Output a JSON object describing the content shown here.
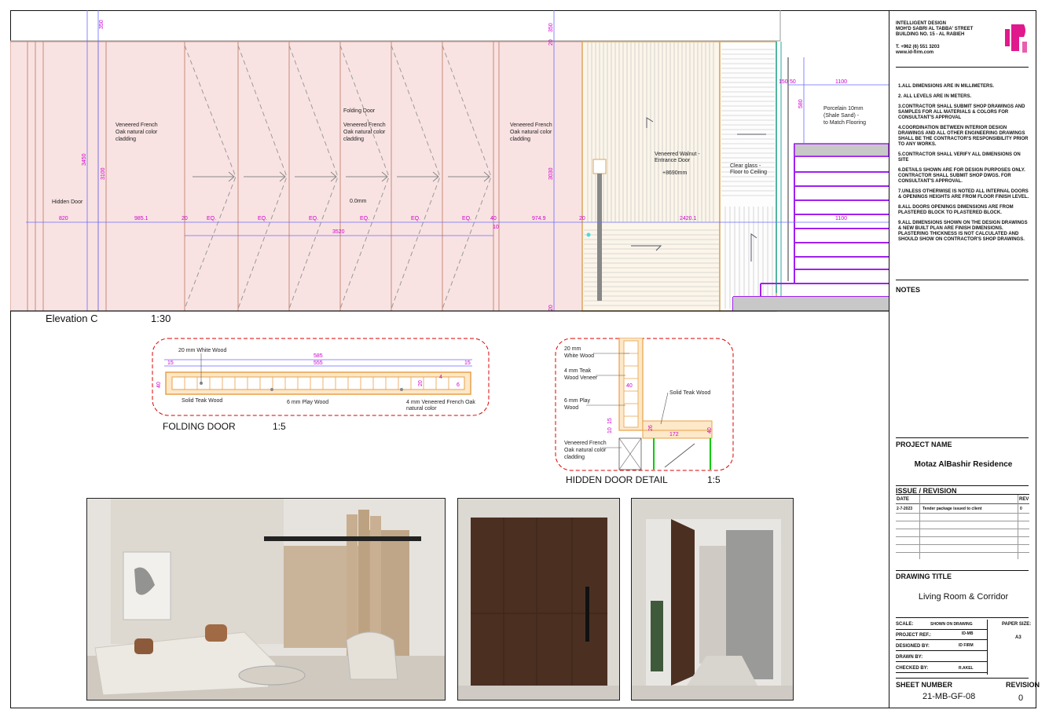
{
  "elevation": {
    "title": "Elevation C",
    "scale": "1:30",
    "labels": {
      "hidden_door": "Hidden Door",
      "veneer_left_1": "Veneered French",
      "veneer_left_2": "Oak natural color",
      "veneer_left_3": "cladding",
      "folding_door": "Folding Door",
      "veneer_mid_1": "Veneered French",
      "veneer_mid_2": "Oak natural color",
      "veneer_mid_3": "cladding",
      "veneer_right_1": "Veneered French",
      "veneer_right_2": "Oak natural color",
      "veneer_right_3": "cladding",
      "walnut_1": "Veneered Walnut -",
      "walnut_2": "Entrance Door",
      "walnut_3": "+8690mm",
      "glass_1": "Clear glass -",
      "glass_2": "Floor to Ceiling",
      "porcelain_1": "Porcelain 10mm",
      "porcelain_2": "(Shale Sand) -",
      "porcelain_3": "to Match Flooring",
      "level": "0.0mm"
    },
    "dims": {
      "d350a": "350",
      "d350b": "350",
      "d3450": "3450",
      "d3100": "3100",
      "d3030": "3030",
      "d20a": "20",
      "d20b": "20",
      "d820": "820",
      "d985": "985.1",
      "d20c": "20",
      "eq1": "EQ.",
      "eq2": "EQ.",
      "eq3": "EQ.",
      "eq4": "EQ.",
      "eq5": "EQ.",
      "eq6": "EQ.",
      "d40": "40",
      "d10": "10",
      "d974": "974.9",
      "d20d": "20",
      "d2420": "2420.1",
      "d1100a": "1100",
      "d1100b": "1100",
      "d3520": "3520",
      "d580": "580",
      "d150": "150",
      "d50": "50"
    }
  },
  "folding_door": {
    "title": "FOLDING DOOR",
    "scale": "1:5",
    "labels": {
      "white_wood": "20 mm White Wood",
      "solid_teak": "Solid Teak Wood",
      "play_wood": "6 mm Play Wood",
      "veneer_1": "4 mm Veneered French Oak",
      "veneer_2": "natural color"
    },
    "dims": {
      "d585": "585",
      "d555": "555",
      "d15a": "15",
      "d15b": "15",
      "d40": "40",
      "d20": "20",
      "d4": "4",
      "d6": "6"
    }
  },
  "hidden_door": {
    "title": "HIDDEN DOOR DETAIL",
    "scale": "1:5",
    "labels": {
      "white_1": "20 mm",
      "white_2": "White Wood",
      "teak_v1": "4 mm Teak",
      "teak_v2": "Wood Veneer",
      "play_1": "6 mm Play",
      "play_2": "Wood",
      "solid_teak": "Solid Teak Wood",
      "veneer_1": "Veneered French",
      "veneer_2": "Oak natural color",
      "veneer_3": "cladding"
    },
    "dims": {
      "d40a": "40",
      "d26": "26",
      "d172": "172",
      "d40b": "40",
      "d10": "10",
      "d15": "15"
    }
  },
  "title_block": {
    "company": [
      "INTELLIGENT DESIGN",
      "MOH'D SABRI AL TABBA' STREET",
      "BUILDING NO. 15 - AL RABIEH"
    ],
    "phone": "T. +962 (6) 551 3203",
    "web": "www.id-firm.com",
    "notes": [
      "1.ALL DIMENSIONS ARE IN MILLIMETERS.",
      "2. ALL LEVELS ARE IN METERS.",
      "3.CONTRACTOR SHALL SUBMIT SHOP DRAWINGS AND SAMPLES FOR ALL MATERIALS & COLORS FOR CONSULTANT'S APPROVAL",
      "4.COORDINATION BETWEEN INTERIOR DESIGN DRAWINGS AND ALL OTHER ENGINEERING DRAWINGS SHALL BE THE CONTRACTOR'S RESPONSIBILITY PRIOR TO ANY WORKS.",
      "5.CONTRACTOR SHALL VERIFY ALL DIMENSIONS ON SITE",
      "6.DETAILS SHOWN ARE FOR DESIGN PURPOSES ONLY. CONTRACTOR SHALL SUBMIT SHOP DWGS. FOR CONSULTANT'S APPROVAL.",
      "7.UNLESS OTHERWISE IS NOTED ALL INTERNAL DOORS & OPENINGS HEIGHTS ARE FROM FLOOR FINISH LEVEL.",
      "8.ALL DOORS OPENINGS DIMENSIONS ARE FROM PLASTERED BLOCK TO PLASTERED BLOCK.",
      "9.ALL DIMENSIONS SHOWN ON THE DESIGN DRAWINGS & NEW BUILT PLAN ARE FINISH DIMENSIONS. PLASTERING THICKNESS IS NOT CALCULATED AND SHOULD SHOW ON CONTRACTOR'S SHOP DRAWINGS."
    ],
    "notes_heading": "NOTES",
    "project_name_label": "PROJECT NAME",
    "project_name": "Motaz AlBashir Residence",
    "issue_label": "ISSUE / REVISION",
    "issue_cols": {
      "date": "DATE",
      "rev": "REV"
    },
    "issue_row": {
      "date": "2-7-2023",
      "desc": "Tender package issued to client",
      "rev": "0"
    },
    "drawing_title_label": "DRAWING TITLE",
    "drawing_title": "Living Room & Corridor",
    "scale_label": "SCALE:",
    "scale_value": "SHOWN ON DRAWING",
    "paper_label": "PAPER SIZE:",
    "paper_value": "A3",
    "project_ref_label": "PROJECT REF.:",
    "project_ref": "ID-MB",
    "designed_label": "DESIGNED BY:",
    "designed": "ID FIRM",
    "drawn_label": "DRAWN BY:",
    "drawn": "",
    "checked_label": "CHECKED BY:",
    "checked": "R.AKEL",
    "sheet_label": "SHEET NUMBER",
    "sheet": "21-MB-GF-08",
    "revision_label": "REVISION",
    "revision": "0"
  },
  "colors": {
    "accent": "#e0198c",
    "dim": "#d000d0",
    "wood": "#e8a04a",
    "veneer": "#f6dede"
  }
}
